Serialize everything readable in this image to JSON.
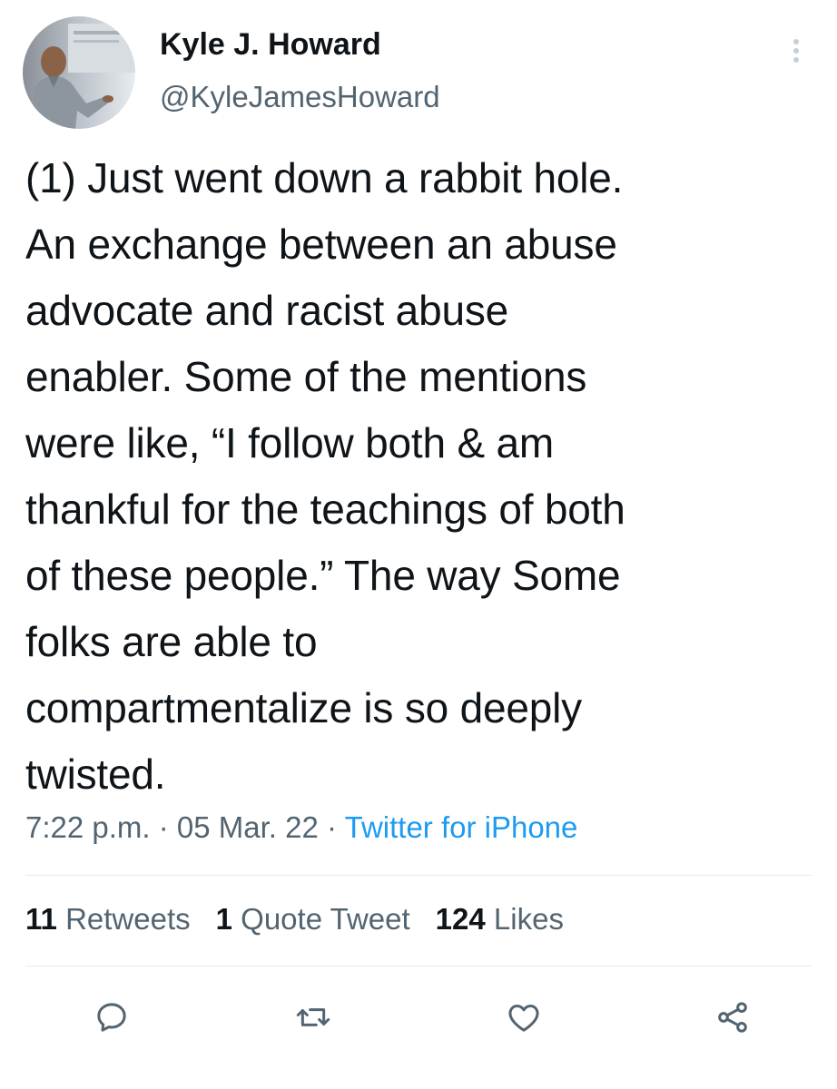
{
  "author": {
    "name": "Kyle J. Howard",
    "handle": "@KyleJamesHoward"
  },
  "tweet": {
    "text": "(1) Just went down a rabbit hole.\nAn exchange between an abuse\nadvocate and racist abuse\nenabler. Some of the mentions\nwere like, “I follow both & am\nthankful for the teachings of both\nof these people.” The way Some\nfolks are able to\ncompartmentalize is so deeply\ntwisted.",
    "time": "7:22 p.m.",
    "separator": "·",
    "date": "05 Mar. 22",
    "source": "Twitter for iPhone"
  },
  "stats": {
    "retweets_count": "11",
    "retweets_label": "Retweets",
    "quotes_count": "1",
    "quotes_label": "Quote Tweet",
    "likes_count": "124",
    "likes_label": "Likes"
  },
  "icons": {
    "reply": "reply-icon",
    "retweet": "retweet-icon",
    "like": "heart-icon",
    "share": "share-icon",
    "more": "more-icon"
  },
  "colors": {
    "text": "#0f1419",
    "secondary": "#536471",
    "link": "#1d9bf0",
    "divider": "#e5e9ec"
  }
}
